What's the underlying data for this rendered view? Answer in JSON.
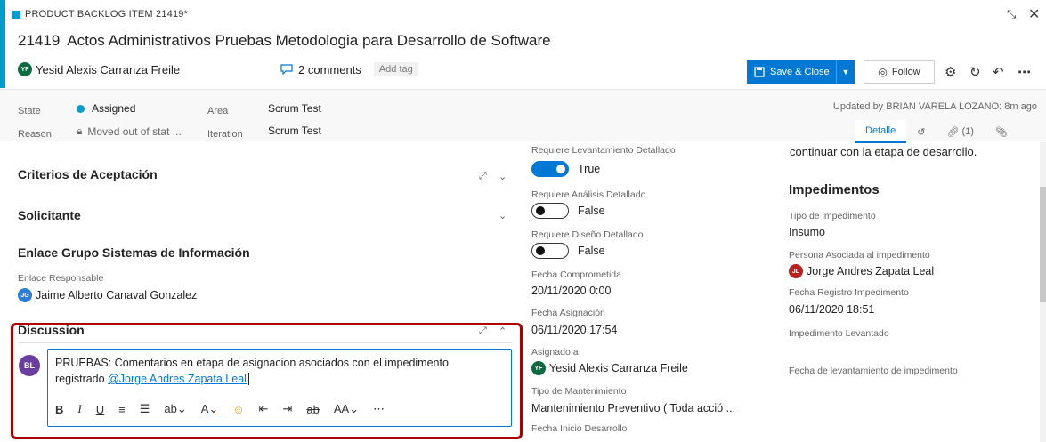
{
  "header": {
    "type_label": "PRODUCT BACKLOG ITEM 21419*",
    "id": "21419",
    "title": "Actos Administrativos Pruebas Metodologia para Desarrollo de Software",
    "owner_initials": "YF",
    "owner_name": "Yesid Alexis Carranza Freile",
    "comments": "2 comments",
    "add_tag": "Add tag",
    "expand_glyph": "⤡",
    "close_glyph": "✕"
  },
  "toolbar": {
    "save_label": "Save & Close",
    "follow_label": "Follow",
    "accent_color": "#0078d4"
  },
  "fields": {
    "state_label": "State",
    "state_value": "Assigned",
    "reason_label": "Reason",
    "reason_value": "Moved out of stat ...",
    "area_label": "Area",
    "area_value": "Scrum Test",
    "iteration_label": "Iteration",
    "iteration_value": "Scrum Test",
    "updated_text": "Updated by BRIAN VARELA LOZANO: 8m ago"
  },
  "tabs": {
    "detalle": "Detalle",
    "links": "(1)"
  },
  "left": {
    "criterios": "Criterios de Aceptación",
    "solicitante": "Solicitante",
    "enlace_grupo": "Enlace Grupo Sistemas de Información",
    "enlace_resp_label": "Enlace Responsable",
    "enlace_resp_initials": "JG",
    "enlace_resp_value": "Jaime Alberto Canaval Gonzalez"
  },
  "discussion": {
    "title": "Discussion",
    "avatar_initials": "BL",
    "text": "PRUEBAS: Comentarios en etapa de asignacion asociados con el impedimento registrado",
    "mention": "@Jorge Andres Zapata Leal"
  },
  "middle": {
    "req_lev_label": "Requiere Levantamiento Detallado",
    "req_lev_value": "True",
    "req_ana_label": "Requiere Análisis Detallado",
    "req_ana_value": "False",
    "req_dis_label": "Requiere Diseño Detallado",
    "req_dis_value": "False",
    "fecha_comp_label": "Fecha Comprometida",
    "fecha_comp_value": "20/11/2020 0:00",
    "fecha_asig_label": "Fecha Asignación",
    "fecha_asig_value": "06/11/2020 17:54",
    "asignado_label": "Asignado a",
    "asignado_initials": "YF",
    "asignado_value": "Yesid Alexis Carranza Freile",
    "tipo_mant_label": "Tipo de Mantenimiento",
    "tipo_mant_value": "Mantenimiento Preventivo ( Toda acció ...",
    "fecha_ini_label": "Fecha Inicio Desarrollo"
  },
  "right": {
    "top_text": "continuar con la etapa de desarrollo.",
    "impedimentos": "Impedimentos",
    "tipo_imp_label": "Tipo de impedimento",
    "tipo_imp_value": "Insumo",
    "persona_label": "Persona Asociada al impedimento",
    "persona_initials": "JL",
    "persona_value": "Jorge Andres Zapata Leal",
    "fecha_reg_label": "Fecha Registro Impedimento",
    "fecha_reg_value": "06/11/2020 18:51",
    "imp_lev_label": "Impedimento Levantado",
    "fecha_lev_label": "Fecha de levantamiento de impedimento"
  }
}
